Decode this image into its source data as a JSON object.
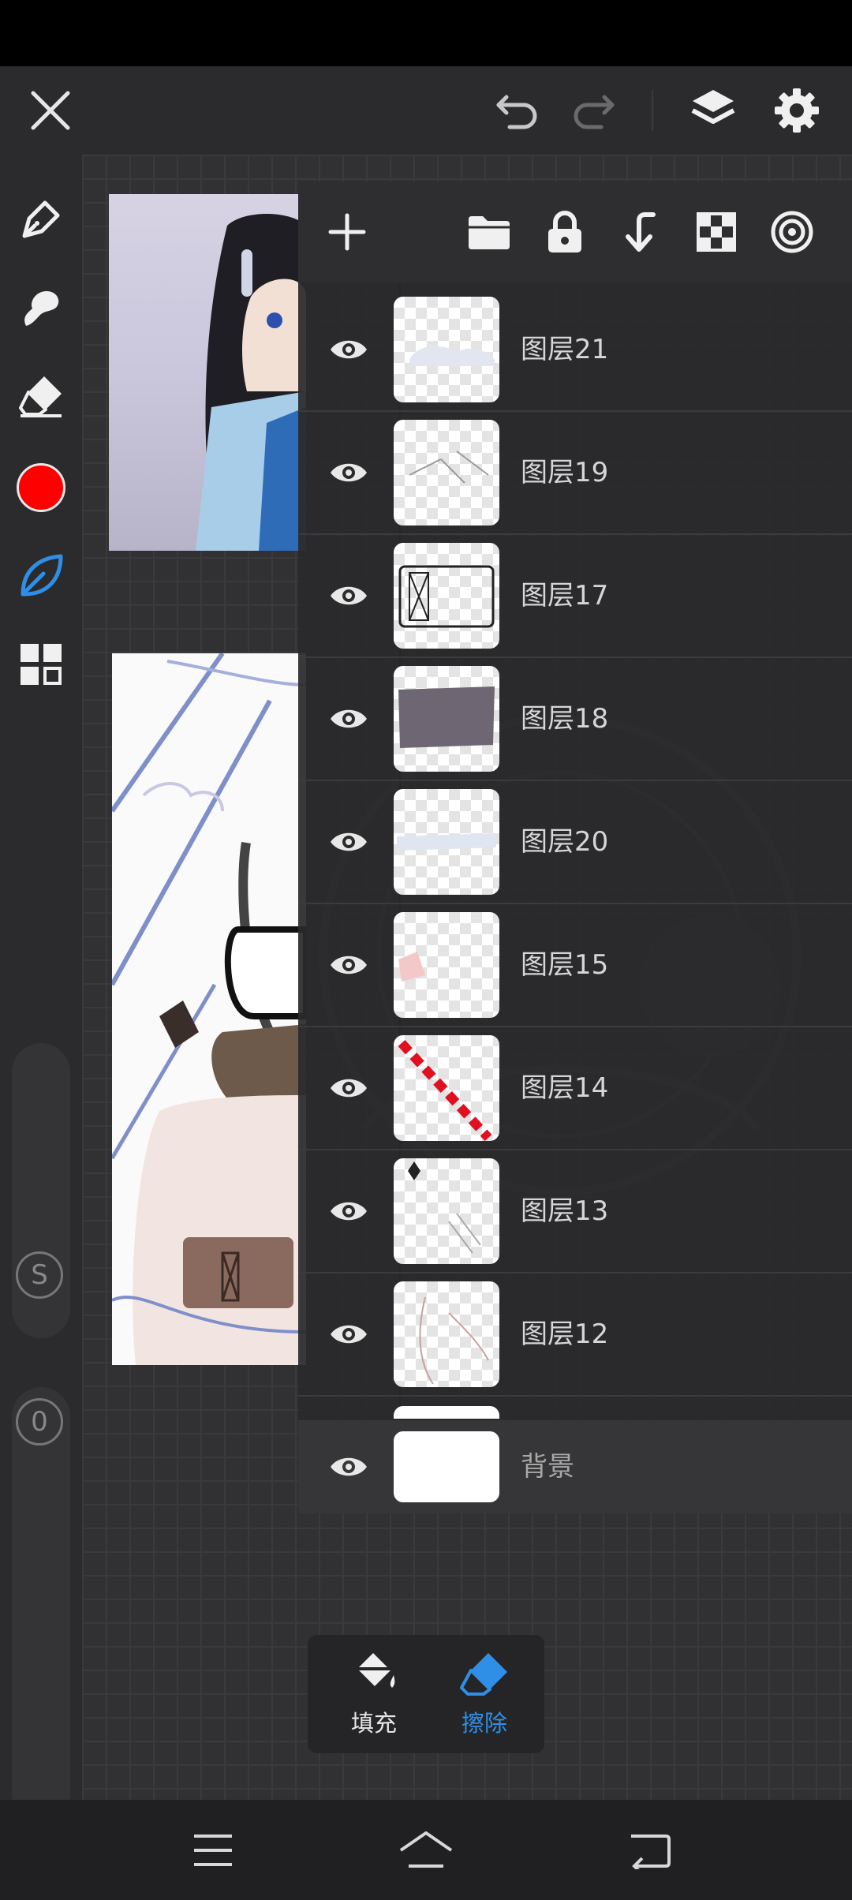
{
  "toolbar": {
    "close_icon": "close-icon",
    "undo_icon": "undo-icon",
    "redo_icon": "redo-icon",
    "layers_icon": "layers-icon",
    "settings_icon": "gear-icon"
  },
  "left_tools": {
    "items": [
      "pen-icon",
      "smudge-icon",
      "eraser-icon",
      "color-swatch",
      "leaf-brush-icon",
      "grid-menu-icon"
    ],
    "current_color": "#ff0000",
    "active_tool_color": "#2f8fe6",
    "size_label": "S",
    "opacity_label": "0"
  },
  "layer_panel": {
    "toolbar": [
      "add-layer-icon",
      "folder-icon",
      "lock-icon",
      "merge-down-icon",
      "transparency-icon",
      "target-icon"
    ],
    "layers": [
      {
        "name": "图层21"
      },
      {
        "name": "图层19"
      },
      {
        "name": "图层17"
      },
      {
        "name": "图层18"
      },
      {
        "name": "图层20"
      },
      {
        "name": "图层15"
      },
      {
        "name": "图层14"
      },
      {
        "name": "图层13"
      },
      {
        "name": "图层12"
      }
    ],
    "background_layer": {
      "name": "背景"
    }
  },
  "bottom_actions": {
    "fill_label": "填充",
    "erase_label": "擦除",
    "active_color": "#2f8fe6"
  }
}
